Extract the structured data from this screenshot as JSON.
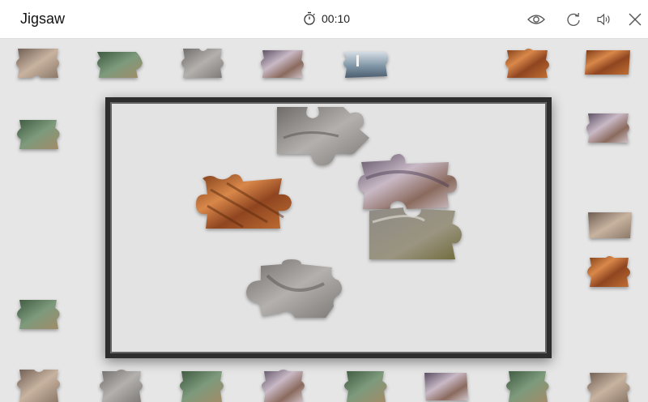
{
  "app": {
    "title": "Jigsaw"
  },
  "timer": {
    "value": "00:10",
    "icon": "stopwatch-icon"
  },
  "toolbar": [
    {
      "name": "preview-button",
      "icon": "eye-icon"
    },
    {
      "name": "restart-button",
      "icon": "refresh-icon"
    },
    {
      "name": "sound-button",
      "icon": "speaker-icon"
    },
    {
      "name": "close-button",
      "icon": "close-icon"
    }
  ],
  "colors": {
    "orange_rock": "#b05c28",
    "gray_rock": "#8d8a87",
    "green_water": "#4e6f52",
    "purple_rock": "#7b6a80",
    "tan_rock": "#a8866a"
  }
}
